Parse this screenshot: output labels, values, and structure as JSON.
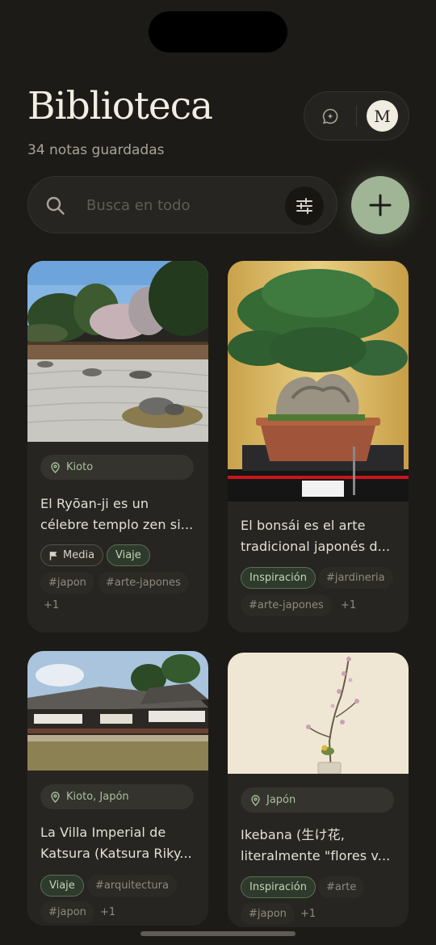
{
  "header": {
    "title": "Biblioteca",
    "subtitle": "34 notas guardadas",
    "avatar_initial": "M"
  },
  "search": {
    "placeholder": "Busca en todo"
  },
  "icons": {
    "search": "search-icon",
    "filter": "sliders-icon",
    "add": "plus-icon",
    "chat": "chat-sparkle-icon",
    "location": "location-pin-icon",
    "media": "flag-icon"
  },
  "colors": {
    "background": "#1c1b17",
    "card": "#262521",
    "accent": "#9fb596",
    "location_text": "#a9c19c"
  },
  "cards": [
    {
      "image": "zen-rock-garden",
      "location": "Kioto",
      "text_line1": "El Ryōan-ji es un",
      "text_line2": "célebre templo zen si...",
      "chips": [
        "Media",
        "Viaje"
      ],
      "tags": [
        "#japon",
        "#arte-japones"
      ],
      "more": "+1"
    },
    {
      "image": "bonsai-tree",
      "text_line1": "El bonsái es el arte",
      "text_line2": "tradicional japonés d...",
      "chips": [
        "Inspiración"
      ],
      "tags": [
        "#jardineria",
        "#arte-japones"
      ],
      "more": "+1"
    },
    {
      "image": "katsura-villa",
      "location": "Kioto, Japón",
      "text_line1": "La Villa Imperial de",
      "text_line2": "Katsura (Katsura Riky...",
      "chips": [
        "Viaje"
      ],
      "tags": [
        "#arquitectura",
        "#japon"
      ],
      "more": "+1"
    },
    {
      "image": "ikebana-branch",
      "location": "Japón",
      "text_line1": "Ikebana (生け花,",
      "text_line2": "literalmente \"flores v...",
      "chips": [
        "Inspiración"
      ],
      "tags": [
        "#arte",
        "#japon"
      ],
      "more": "+1"
    }
  ]
}
